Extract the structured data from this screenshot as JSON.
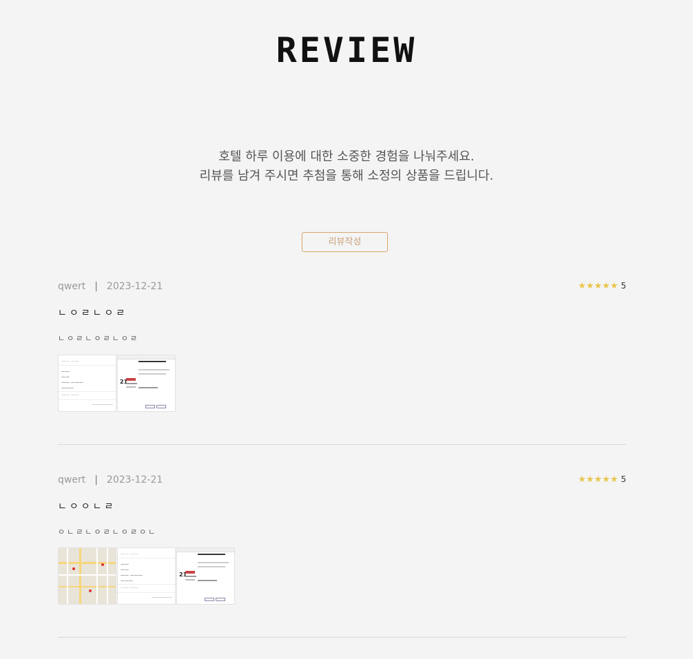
{
  "header": {
    "title": "REVIEW"
  },
  "intro": {
    "line1": "호텔 하루 이용에 대한 소중한 경험을 나눠주세요.",
    "line2": "리뷰를 남겨 주시면 추첨을 통해 소정의 상품을 드립니다."
  },
  "write_button": {
    "label": "리뷰작성"
  },
  "colors": {
    "accent": "#d9a36a",
    "star": "#e9c64a",
    "background": "#f4f4f4"
  },
  "reviews": [
    {
      "user": "qwert",
      "separator": "|",
      "date": "2023-12-21",
      "rating": 5,
      "rating_text": "5",
      "title": "ㄴㅇㄹㄴㅇㄹ",
      "body": "ㄴㅇㄹㄴㅇㄹㄴㅇㄹ",
      "images": [
        "form-screenshot",
        "dialog-screenshot"
      ]
    },
    {
      "user": "qwert",
      "separator": "|",
      "date": "2023-12-21",
      "rating": 5,
      "rating_text": "5",
      "title": "ㄴㅇㅇㄴㄹ",
      "body": "ㅇㄴㄹㄴㅇㄹㄴㅇㄹㅇㄴ",
      "images": [
        "map-screenshot",
        "form-screenshot",
        "dialog-screenshot"
      ]
    }
  ]
}
